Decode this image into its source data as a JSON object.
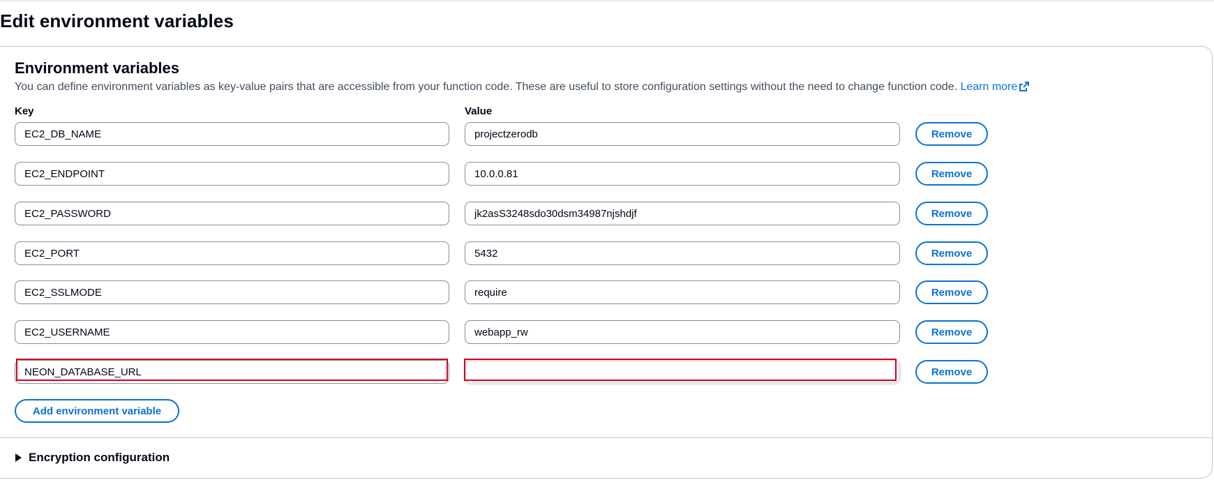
{
  "page_title": "Edit environment variables",
  "panel": {
    "title": "Environment variables",
    "description": "You can define environment variables as key-value pairs that are accessible from your function code. These are useful to store configuration settings without the need to change function code.",
    "learn_more": "Learn more",
    "key_label": "Key",
    "value_label": "Value"
  },
  "variables": [
    {
      "key": "EC2_DB_NAME",
      "value": "projectzerodb",
      "remove_label": "Remove"
    },
    {
      "key": "EC2_ENDPOINT",
      "value": "10.0.0.81",
      "remove_label": "Remove"
    },
    {
      "key": "EC2_PASSWORD",
      "value": "jk2asS3248sdo30dsm34987njshdjf",
      "remove_label": "Remove"
    },
    {
      "key": "EC2_PORT",
      "value": "5432",
      "remove_label": "Remove"
    },
    {
      "key": "EC2_SSLMODE",
      "value": "require",
      "remove_label": "Remove"
    },
    {
      "key": "EC2_USERNAME",
      "value": "webapp_rw",
      "remove_label": "Remove"
    },
    {
      "key": "NEON_DATABASE_URL",
      "value": "",
      "remove_label": "Remove"
    }
  ],
  "add_button_label": "Add environment variable",
  "encryption_label": "Encryption configuration",
  "colors": {
    "accent": "#0972d3",
    "highlight": "#d0021b",
    "text": "#000716"
  }
}
